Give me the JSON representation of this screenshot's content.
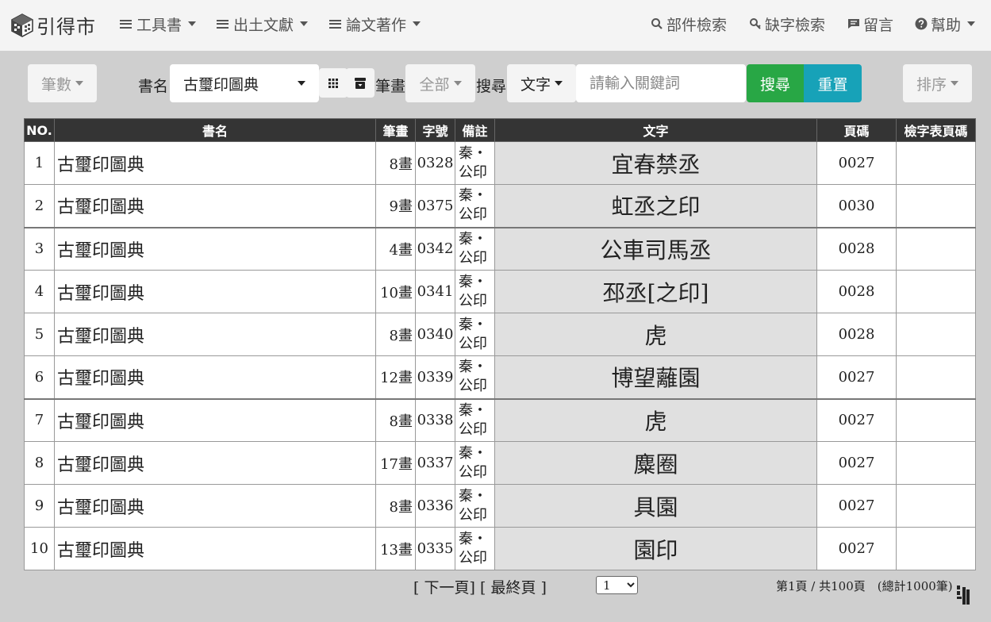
{
  "app": {
    "logo_text": "引得市"
  },
  "nav": {
    "left": [
      {
        "label": "工具書"
      },
      {
        "label": "出土文獻"
      },
      {
        "label": "論文著作"
      }
    ],
    "right": [
      {
        "label": "部件檢索",
        "icon": "search-icon"
      },
      {
        "label": "缺字檢索",
        "icon": "key-search-icon"
      },
      {
        "label": "留言",
        "icon": "comment-icon"
      },
      {
        "label": "幫助",
        "icon": "question-icon"
      }
    ]
  },
  "toolbar": {
    "stroke_filter": "筆數",
    "book_label": "書名",
    "book_value": "古璽印圖典",
    "stroke_label": "筆畫",
    "stroke_value": "全部",
    "search_label": "搜尋",
    "search_field": "文字",
    "search_placeholder": "請輸入關鍵詞",
    "search_button": "搜尋",
    "reset_button": "重置",
    "sort_button": "排序"
  },
  "colors": {
    "search_button": "#28a745",
    "reset_button": "#17a2b8",
    "header_bg": "#343434"
  },
  "table": {
    "headers": [
      "NO.",
      "書名",
      "筆畫",
      "字號",
      "備註",
      "文字",
      "頁碼",
      "檢字表頁碼"
    ],
    "rows": [
      {
        "no": "1",
        "book": "古璽印圖典",
        "stroke": "8畫",
        "code": "0328",
        "note": "秦・公印",
        "text": "宜春禁丞",
        "page": "0027",
        "index_page": ""
      },
      {
        "no": "2",
        "book": "古璽印圖典",
        "stroke": "9畫",
        "code": "0375",
        "note": "秦・公印",
        "text": "虹丞之印",
        "page": "0030",
        "index_page": ""
      },
      {
        "no": "3",
        "book": "古璽印圖典",
        "stroke": "4畫",
        "code": "0342",
        "note": "秦・公印",
        "text": "公車司馬丞",
        "page": "0028",
        "index_page": ""
      },
      {
        "no": "4",
        "book": "古璽印圖典",
        "stroke": "10畫",
        "code": "0341",
        "note": "秦・公印",
        "text": "邳丞[之印]",
        "page": "0028",
        "index_page": ""
      },
      {
        "no": "5",
        "book": "古璽印圖典",
        "stroke": "8畫",
        "code": "0340",
        "note": "秦・公印",
        "text": "虎",
        "page": "0028",
        "index_page": ""
      },
      {
        "no": "6",
        "book": "古璽印圖典",
        "stroke": "12畫",
        "code": "0339",
        "note": "秦・公印",
        "text": "博望蘺園",
        "page": "0027",
        "index_page": ""
      },
      {
        "no": "7",
        "book": "古璽印圖典",
        "stroke": "8畫",
        "code": "0338",
        "note": "秦・公印",
        "text": "虎",
        "page": "0027",
        "index_page": ""
      },
      {
        "no": "8",
        "book": "古璽印圖典",
        "stroke": "17畫",
        "code": "0337",
        "note": "秦・公印",
        "text": "麋圈",
        "page": "0027",
        "index_page": ""
      },
      {
        "no": "9",
        "book": "古璽印圖典",
        "stroke": "8畫",
        "code": "0336",
        "note": "秦・公印",
        "text": "具園",
        "page": "0027",
        "index_page": ""
      },
      {
        "no": "10",
        "book": "古璽印圖典",
        "stroke": "13畫",
        "code": "0335",
        "note": "秦・公印",
        "text": "園印",
        "page": "0027",
        "index_page": ""
      }
    ]
  },
  "pagination": {
    "next_label": "[ 下一頁]",
    "last_label": "[ 最終頁 ]",
    "page_select": "1",
    "info": "第1頁 / 共100頁　(總計1000筆)"
  }
}
